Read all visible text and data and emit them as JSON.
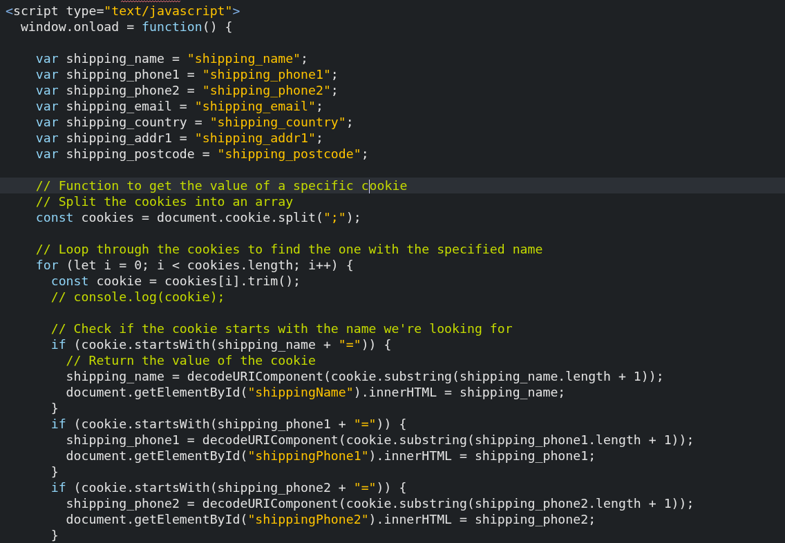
{
  "editor": {
    "lines": [
      {
        "kind": "code",
        "tokens": [
          {
            "kind": "tag",
            "text": "<"
          },
          {
            "kind": "plain",
            "text": "script type="
          },
          {
            "kind": "string",
            "text": "\"text/javascript\""
          },
          {
            "kind": "tag",
            "text": ">"
          }
        ]
      },
      {
        "kind": "code",
        "tokens": [
          {
            "kind": "plain",
            "text": "  window.onload = "
          },
          {
            "kind": "keyword",
            "text": "function"
          },
          {
            "kind": "plain",
            "text": "() {"
          }
        ]
      },
      {
        "kind": "blank"
      },
      {
        "kind": "code",
        "tokens": [
          {
            "kind": "keyword",
            "text": "    var"
          },
          {
            "kind": "plain",
            "text": " shipping_name = "
          },
          {
            "kind": "string",
            "text": "\"shipping_name\""
          },
          {
            "kind": "plain",
            "text": ";"
          }
        ]
      },
      {
        "kind": "code",
        "tokens": [
          {
            "kind": "keyword",
            "text": "    var"
          },
          {
            "kind": "plain",
            "text": " shipping_phone1 = "
          },
          {
            "kind": "string",
            "text": "\"shipping_phone1\""
          },
          {
            "kind": "plain",
            "text": ";"
          }
        ]
      },
      {
        "kind": "code",
        "tokens": [
          {
            "kind": "keyword",
            "text": "    var"
          },
          {
            "kind": "plain",
            "text": " shipping_phone2 = "
          },
          {
            "kind": "string",
            "text": "\"shipping_phone2\""
          },
          {
            "kind": "plain",
            "text": ";"
          }
        ]
      },
      {
        "kind": "code",
        "tokens": [
          {
            "kind": "keyword",
            "text": "    var"
          },
          {
            "kind": "plain",
            "text": " shipping_email = "
          },
          {
            "kind": "string",
            "text": "\"shipping_email\""
          },
          {
            "kind": "plain",
            "text": ";"
          }
        ]
      },
      {
        "kind": "code",
        "tokens": [
          {
            "kind": "keyword",
            "text": "    var"
          },
          {
            "kind": "plain",
            "text": " shipping_country = "
          },
          {
            "kind": "string",
            "text": "\"shipping_country\""
          },
          {
            "kind": "plain",
            "text": ";"
          }
        ]
      },
      {
        "kind": "code",
        "tokens": [
          {
            "kind": "keyword",
            "text": "    var"
          },
          {
            "kind": "plain",
            "text": " shipping_addr1 = "
          },
          {
            "kind": "string",
            "text": "\"shipping_addr1\""
          },
          {
            "kind": "plain",
            "text": ";"
          }
        ]
      },
      {
        "kind": "code",
        "tokens": [
          {
            "kind": "keyword",
            "text": "    var"
          },
          {
            "kind": "plain",
            "text": " shipping_postcode = "
          },
          {
            "kind": "string",
            "text": "\"shipping_postcode\""
          },
          {
            "kind": "plain",
            "text": ";"
          }
        ]
      },
      {
        "kind": "blank"
      },
      {
        "kind": "code",
        "current": true,
        "tokens": [
          {
            "kind": "comment",
            "text": "    // Function to get the value of a specific c"
          },
          {
            "kind": "caret"
          },
          {
            "kind": "comment",
            "text": "ookie"
          }
        ]
      },
      {
        "kind": "code",
        "tokens": [
          {
            "kind": "comment",
            "text": "    // Split the cookies into an array"
          }
        ]
      },
      {
        "kind": "code",
        "tokens": [
          {
            "kind": "keyword",
            "text": "    const"
          },
          {
            "kind": "plain",
            "text": " cookies = document.cookie.split("
          },
          {
            "kind": "string",
            "text": "\";\""
          },
          {
            "kind": "plain",
            "text": ");"
          }
        ]
      },
      {
        "kind": "blank"
      },
      {
        "kind": "code",
        "tokens": [
          {
            "kind": "comment",
            "text": "    // Loop through the cookies to find the one with the specified name"
          }
        ]
      },
      {
        "kind": "code",
        "tokens": [
          {
            "kind": "keyword",
            "text": "    for"
          },
          {
            "kind": "plain",
            "text": " (let i = 0; i < cookies.length; i++) {"
          }
        ]
      },
      {
        "kind": "code",
        "tokens": [
          {
            "kind": "keyword",
            "text": "      const"
          },
          {
            "kind": "plain",
            "text": " cookie = cookies[i].trim();"
          }
        ]
      },
      {
        "kind": "code",
        "tokens": [
          {
            "kind": "comment",
            "text": "      // console.log(cookie);"
          }
        ]
      },
      {
        "kind": "blank"
      },
      {
        "kind": "code",
        "tokens": [
          {
            "kind": "comment",
            "text": "      // Check if the cookie starts with the name we're looking for"
          }
        ]
      },
      {
        "kind": "code",
        "tokens": [
          {
            "kind": "keyword",
            "text": "      if"
          },
          {
            "kind": "plain",
            "text": " (cookie.startsWith(shipping_name + "
          },
          {
            "kind": "string",
            "text": "\"=\""
          },
          {
            "kind": "plain",
            "text": ")) {"
          }
        ]
      },
      {
        "kind": "code",
        "tokens": [
          {
            "kind": "comment",
            "text": "        // Return the value of the cookie"
          }
        ]
      },
      {
        "kind": "code",
        "tokens": [
          {
            "kind": "plain",
            "text": "        shipping_name = decodeURIComponent(cookie.substring(shipping_name.length + 1));"
          }
        ]
      },
      {
        "kind": "code",
        "tokens": [
          {
            "kind": "plain",
            "text": "        document.getElementById("
          },
          {
            "kind": "string",
            "text": "\"shippingName\""
          },
          {
            "kind": "plain",
            "text": ").innerHTML = shipping_name;"
          }
        ]
      },
      {
        "kind": "code",
        "tokens": [
          {
            "kind": "plain",
            "text": "      }"
          }
        ]
      },
      {
        "kind": "code",
        "tokens": [
          {
            "kind": "keyword",
            "text": "      if"
          },
          {
            "kind": "plain",
            "text": " (cookie.startsWith(shipping_phone1 + "
          },
          {
            "kind": "string",
            "text": "\"=\""
          },
          {
            "kind": "plain",
            "text": ")) {"
          }
        ]
      },
      {
        "kind": "code",
        "tokens": [
          {
            "kind": "plain",
            "text": "        shipping_phone1 = decodeURIComponent(cookie.substring(shipping_phone1.length + 1));"
          }
        ]
      },
      {
        "kind": "code",
        "tokens": [
          {
            "kind": "plain",
            "text": "        document.getElementById("
          },
          {
            "kind": "string",
            "text": "\"shippingPhone1\""
          },
          {
            "kind": "plain",
            "text": ").innerHTML = shipping_phone1;"
          }
        ]
      },
      {
        "kind": "code",
        "tokens": [
          {
            "kind": "plain",
            "text": "      }"
          }
        ]
      },
      {
        "kind": "code",
        "tokens": [
          {
            "kind": "keyword",
            "text": "      if"
          },
          {
            "kind": "plain",
            "text": " (cookie.startsWith(shipping_phone2 + "
          },
          {
            "kind": "string",
            "text": "\"=\""
          },
          {
            "kind": "plain",
            "text": ")) {"
          }
        ]
      },
      {
        "kind": "code",
        "tokens": [
          {
            "kind": "plain",
            "text": "        shipping_phone2 = decodeURIComponent(cookie.substring(shipping_phone2.length + 1));"
          }
        ]
      },
      {
        "kind": "code",
        "tokens": [
          {
            "kind": "plain",
            "text": "        document.getElementById("
          },
          {
            "kind": "string",
            "text": "\"shippingPhone2\""
          },
          {
            "kind": "plain",
            "text": ").innerHTML = shipping_phone2;"
          }
        ]
      },
      {
        "kind": "code",
        "tokens": [
          {
            "kind": "plain",
            "text": "      }"
          }
        ]
      }
    ]
  }
}
